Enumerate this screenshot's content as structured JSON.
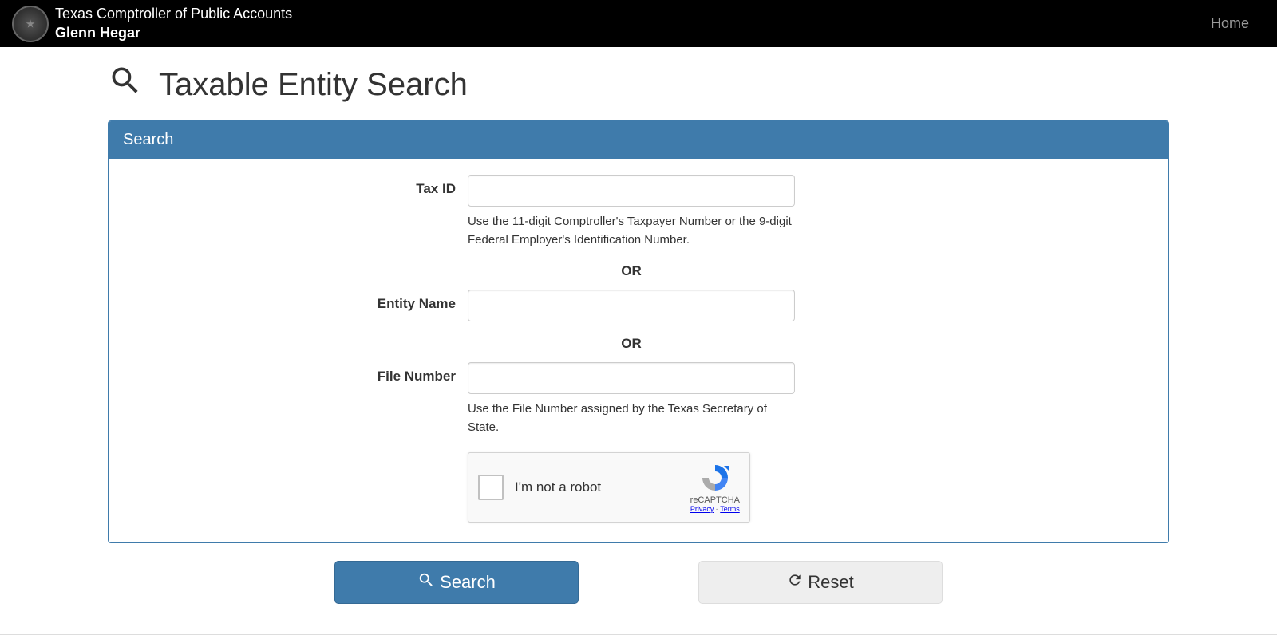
{
  "header": {
    "org": "Texas Comptroller of Public Accounts",
    "name": "Glenn Hegar",
    "home": "Home"
  },
  "page": {
    "title": "Taxable Entity Search"
  },
  "panel": {
    "heading": "Search"
  },
  "form": {
    "taxid_label": "Tax ID",
    "taxid_value": "",
    "taxid_help": "Use the 11-digit Comptroller's Taxpayer Number or the 9-digit Federal Employer's Identification Number.",
    "or1": "OR",
    "entity_label": "Entity Name",
    "entity_value": "",
    "or2": "OR",
    "file_label": "File Number",
    "file_value": "",
    "file_help": "Use the File Number assigned by the Texas Secretary of State."
  },
  "recaptcha": {
    "label": "I'm not a robot",
    "brand": "reCAPTCHA",
    "privacy": "Privacy",
    "terms": "Terms",
    "separator": " - "
  },
  "buttons": {
    "search": "Search",
    "reset": "Reset"
  }
}
